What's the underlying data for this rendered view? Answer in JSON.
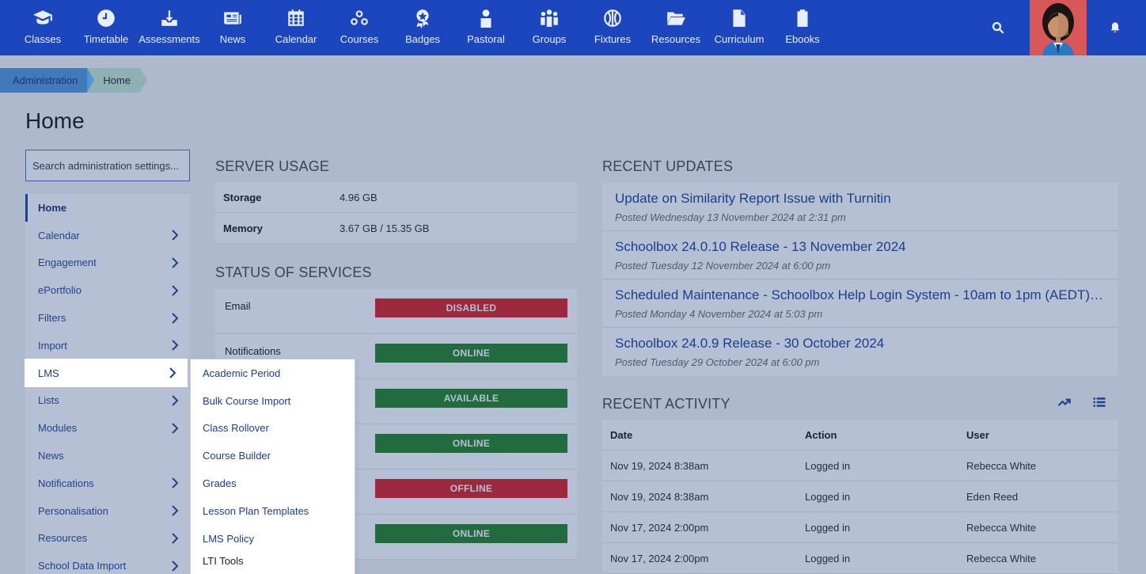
{
  "nav": {
    "items": [
      {
        "label": "Classes",
        "icon": "classes-icon"
      },
      {
        "label": "Timetable",
        "icon": "timetable-icon"
      },
      {
        "label": "Assessments",
        "icon": "assessments-icon"
      },
      {
        "label": "News",
        "icon": "news-icon"
      },
      {
        "label": "Calendar",
        "icon": "calendar-icon"
      },
      {
        "label": "Courses",
        "icon": "courses-icon"
      },
      {
        "label": "Badges",
        "icon": "badges-icon"
      },
      {
        "label": "Pastoral",
        "icon": "pastoral-icon"
      },
      {
        "label": "Groups",
        "icon": "groups-icon"
      },
      {
        "label": "Fixtures",
        "icon": "fixtures-icon"
      },
      {
        "label": "Resources",
        "icon": "resources-icon"
      },
      {
        "label": "Curriculum",
        "icon": "curriculum-icon"
      },
      {
        "label": "Ebooks",
        "icon": "ebooks-icon"
      }
    ]
  },
  "breadcrumb": {
    "admin": "Administration",
    "home": "Home"
  },
  "page": {
    "title": "Home"
  },
  "search": {
    "placeholder": "Search administration settings..."
  },
  "sidebar": {
    "items": [
      {
        "label": "Home"
      },
      {
        "label": "Calendar"
      },
      {
        "label": "Engagement"
      },
      {
        "label": "ePortfolio"
      },
      {
        "label": "Filters"
      },
      {
        "label": "Import"
      },
      {
        "label": "LMS"
      },
      {
        "label": "Lists"
      },
      {
        "label": "Modules"
      },
      {
        "label": "News"
      },
      {
        "label": "Notifications"
      },
      {
        "label": "Personalisation"
      },
      {
        "label": "Resources"
      },
      {
        "label": "School Data Import"
      }
    ]
  },
  "submenu": {
    "items": [
      {
        "label": "Academic Period"
      },
      {
        "label": "Bulk Course Import"
      },
      {
        "label": "Class Rollover"
      },
      {
        "label": "Course Builder"
      },
      {
        "label": "Grades"
      },
      {
        "label": "Lesson Plan Templates"
      },
      {
        "label": "LMS Policy"
      },
      {
        "label": "LTI Tools"
      }
    ]
  },
  "server_usage": {
    "heading": "SERVER USAGE",
    "rows": [
      {
        "key": "Storage",
        "value": "4.96 GB"
      },
      {
        "key": "Memory",
        "value": "3.67 GB / 15.35 GB"
      }
    ]
  },
  "services": {
    "heading": "STATUS OF SERVICES",
    "rows": [
      {
        "name": "Email",
        "status": "DISABLED",
        "color": "#d81a1a"
      },
      {
        "name": "Notifications",
        "status": "ONLINE",
        "color": "#1e7e1e"
      },
      {
        "name": "",
        "status": "AVAILABLE",
        "color": "#1e7e1e"
      },
      {
        "name": "",
        "status": "ONLINE",
        "color": "#1e7e1e"
      },
      {
        "name": "",
        "status": "OFFLINE",
        "color": "#d81a1a"
      },
      {
        "name": "",
        "status": "ONLINE",
        "color": "#1e7e1e"
      }
    ]
  },
  "updates": {
    "heading": "RECENT UPDATES",
    "items": [
      {
        "title": "Update on Similarity Report Issue with Turnitin",
        "date": "Posted Wednesday 13 November 2024 at 2:31 pm"
      },
      {
        "title": "Schoolbox 24.0.10 Release - 13 November 2024",
        "date": "Posted Tuesday 12 November 2024 at 6:00 pm"
      },
      {
        "title": "Scheduled Maintenance - Schoolbox Help Login System - 10am to 1pm (AEDT)…",
        "date": "Posted Monday 4 November 2024 at 5:03 pm"
      },
      {
        "title": "Schoolbox 24.0.9 Release - 30 October 2024",
        "date": "Posted Tuesday 29 October 2024 at 6:00 pm"
      }
    ]
  },
  "activity": {
    "heading": "RECENT ACTIVITY",
    "columns": [
      "Date",
      "Action",
      "User"
    ],
    "rows": [
      [
        "Nov 19, 2024 8:38am",
        "Logged in",
        "Rebecca White"
      ],
      [
        "Nov 19, 2024 8:38am",
        "Logged in",
        "Eden Reed"
      ],
      [
        "Nov 17, 2024 2:00pm",
        "Logged in",
        "Rebecca White"
      ],
      [
        "Nov 17, 2024 2:00pm",
        "Logged in",
        "Rebecca White"
      ]
    ]
  },
  "colors": {
    "nav_bg": "#1b46bd",
    "link": "#1d3f8f",
    "online": "#1e7e1e",
    "offline": "#d81a1a"
  }
}
